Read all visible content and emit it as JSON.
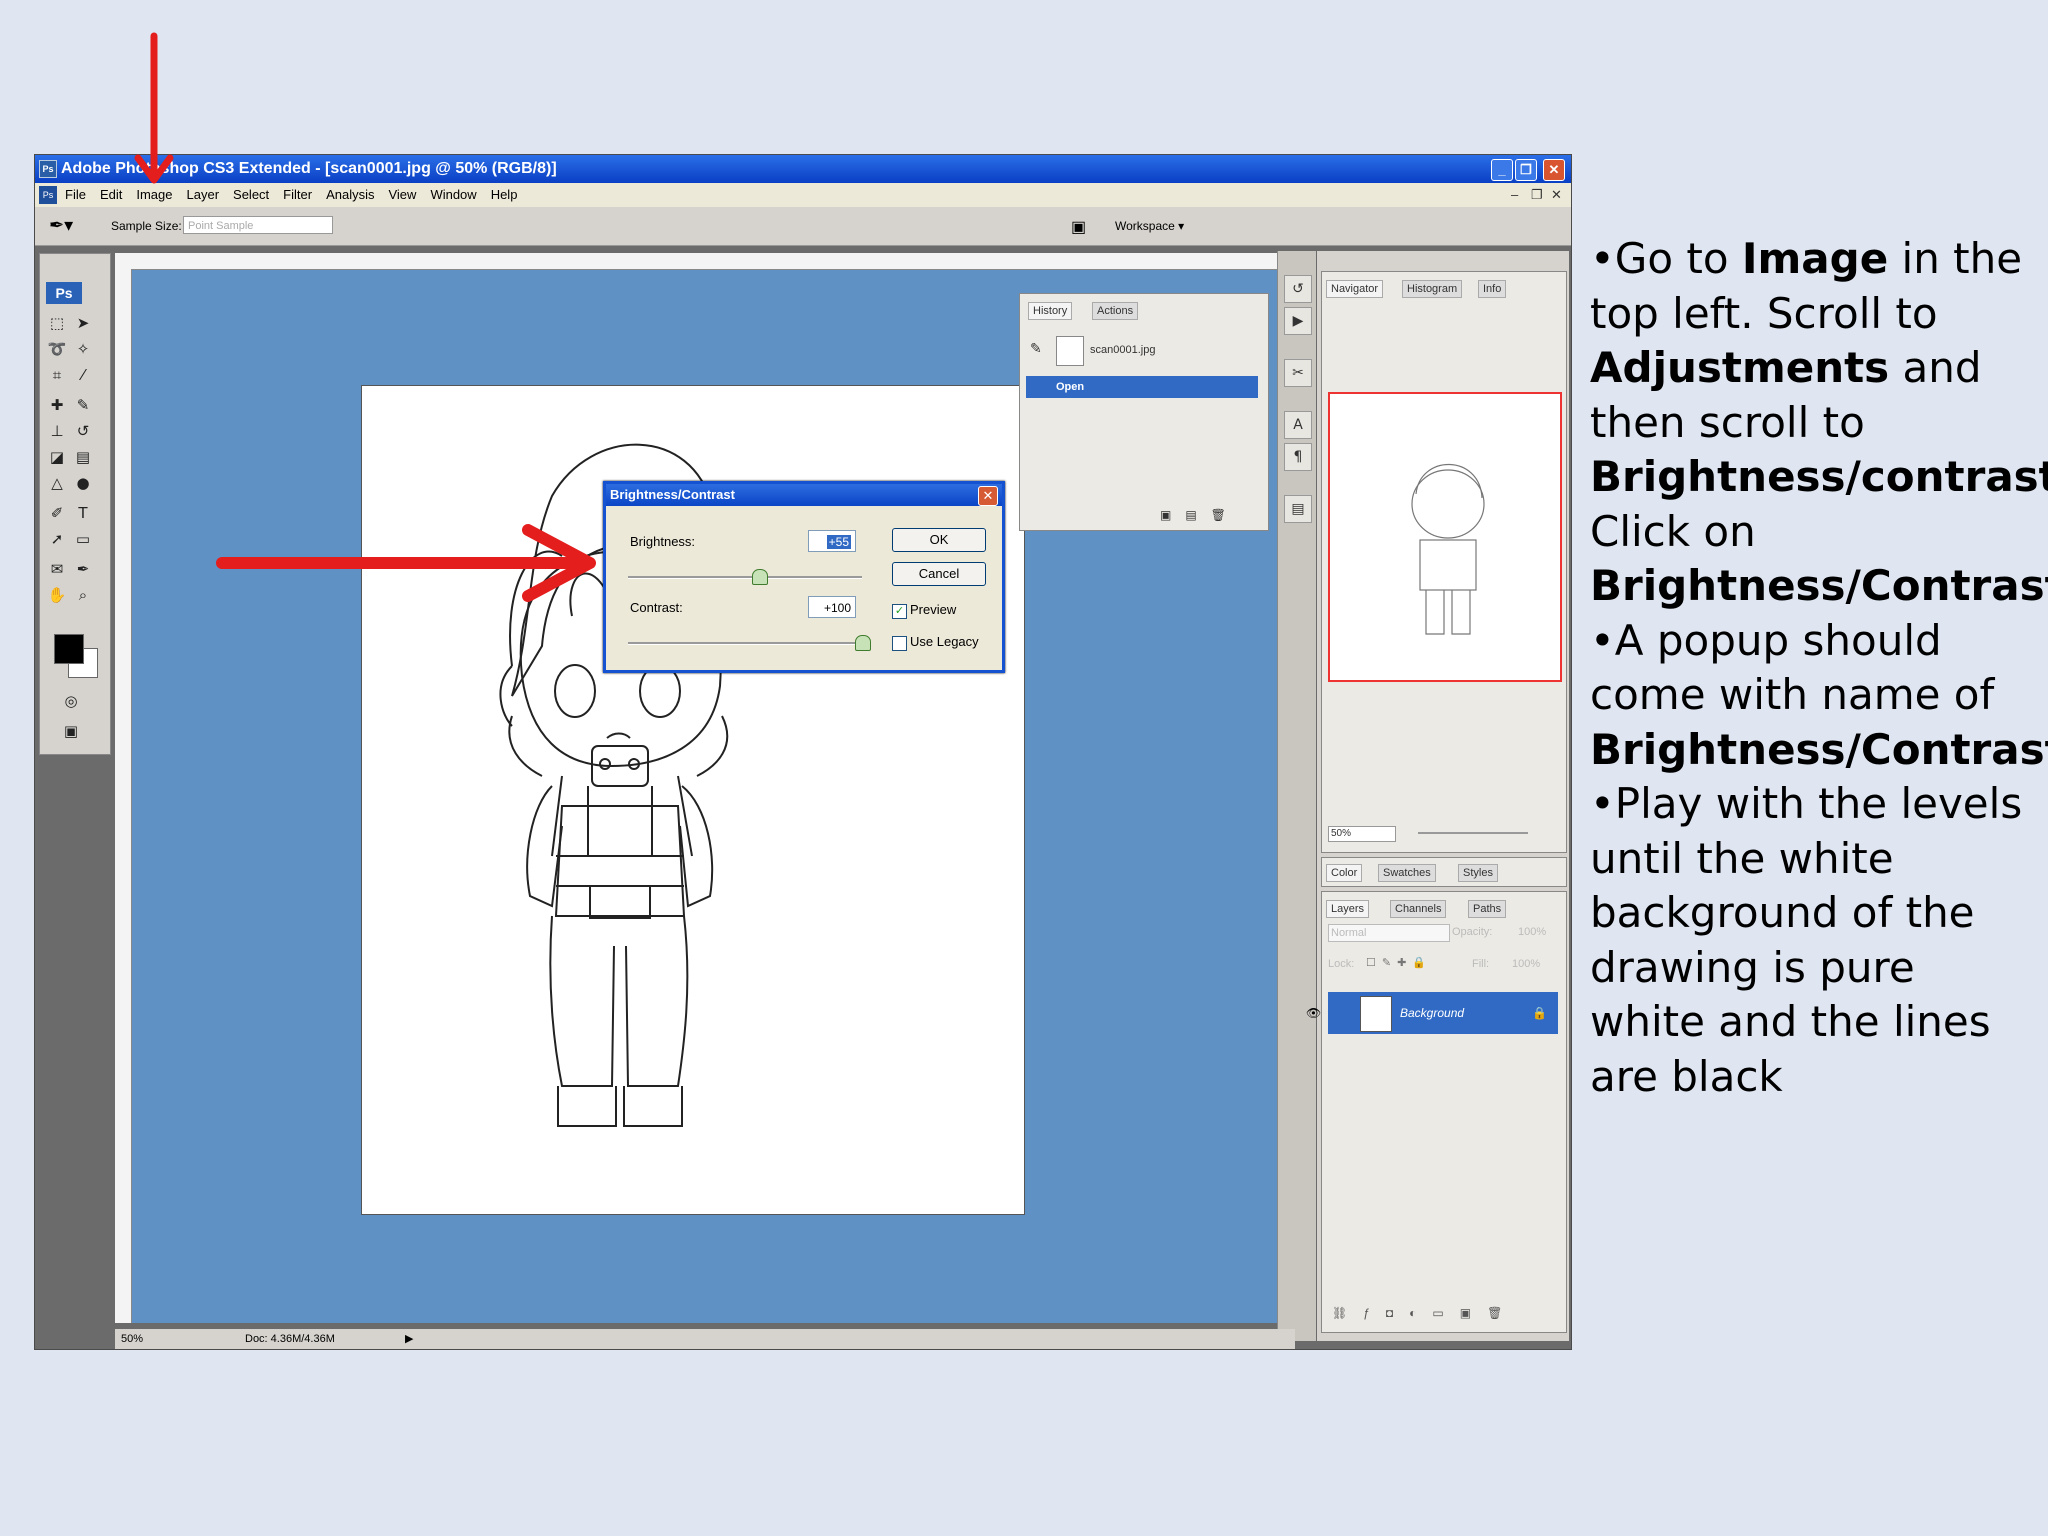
{
  "window": {
    "title": "Adobe Photoshop CS3 Extended - [scan0001.jpg @ 50% (RGB/8)]",
    "ps_icon": "Ps"
  },
  "menubar": {
    "items": [
      "File",
      "Edit",
      "Image",
      "Layer",
      "Select",
      "Filter",
      "Analysis",
      "View",
      "Window",
      "Help"
    ]
  },
  "options_bar": {
    "sample_size_label": "Sample Size:",
    "sample_size_value": "Point Sample",
    "workspace_label": "Workspace ▾"
  },
  "toolbox": {
    "logo": "Ps"
  },
  "status_bar": {
    "zoom": "50%",
    "doc_size": "Doc: 4.36M/4.36M"
  },
  "dialog": {
    "title": "Brightness/Contrast",
    "brightness_label": "Brightness:",
    "brightness_value": "+55",
    "contrast_label": "Contrast:",
    "contrast_value": "+100",
    "brightness_level": 0.56,
    "contrast_level": 1.0,
    "ok_label": "OK",
    "cancel_label": "Cancel",
    "preview_label": "Preview",
    "preview_checked": true,
    "use_legacy_label": "Use Legacy",
    "use_legacy_checked": false
  },
  "history_panel": {
    "tabs": [
      "History",
      "Actions"
    ],
    "snapshot": "scan0001.jpg",
    "step": "Open"
  },
  "navigator_panel": {
    "tabs": [
      "Navigator",
      "Histogram",
      "Info"
    ],
    "zoom": "50%"
  },
  "color_panel": {
    "tabs": [
      "Color",
      "Swatches",
      "Styles"
    ]
  },
  "layers_panel": {
    "tabs": [
      "Layers",
      "Channels",
      "Paths"
    ],
    "blend_mode": "Normal",
    "opacity_label": "Opacity:",
    "opacity_value": "100%",
    "lock_label": "Lock:",
    "fill_label": "Fill:",
    "fill_value": "100%",
    "layer_name": "Background"
  },
  "instructions": {
    "p1": [
      "•Go to ",
      "Image",
      " in the top left. Scroll to ",
      "Adjustments",
      " and then scroll to ",
      "Brightness/contrast",
      ". Click on ",
      "Brightness/Contrast",
      "."
    ],
    "p2": [
      "•A popup should come with name of ",
      "Brightness/Contrast",
      "."
    ],
    "p3": "•Play with the levels until the white background of the drawing is pure white and the lines are black"
  },
  "colors": {
    "page_bg": "#dfe6f2",
    "title_blue": "#0a3fc4",
    "canvas_blue": "#6091c4",
    "arrow_red": "#e41d1d",
    "selection_blue": "#316ac5"
  }
}
